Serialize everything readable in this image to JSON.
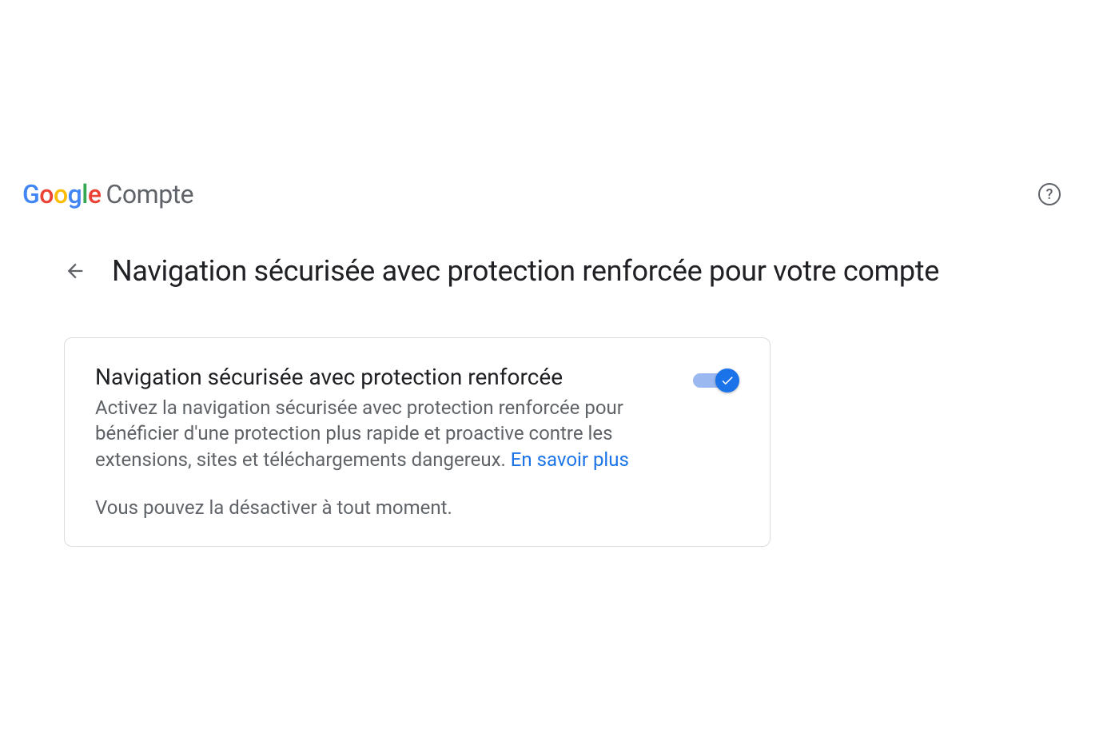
{
  "header": {
    "logo_text": "Google",
    "account_label": "Compte"
  },
  "page": {
    "title": "Navigation sécurisée avec protection renforcée pour votre compte"
  },
  "card": {
    "title": "Navigation sécurisée avec protection renforcée",
    "description": "Activez la navigation sécurisée avec protection renforcée pour béné­ficier d'une protection plus rapide et proactive contre les extensions, sites et téléchargements dangereux. ",
    "learn_more": "En savoir plus",
    "note": "Vous pouvez la désactiver à tout moment.",
    "toggle_on": true
  }
}
